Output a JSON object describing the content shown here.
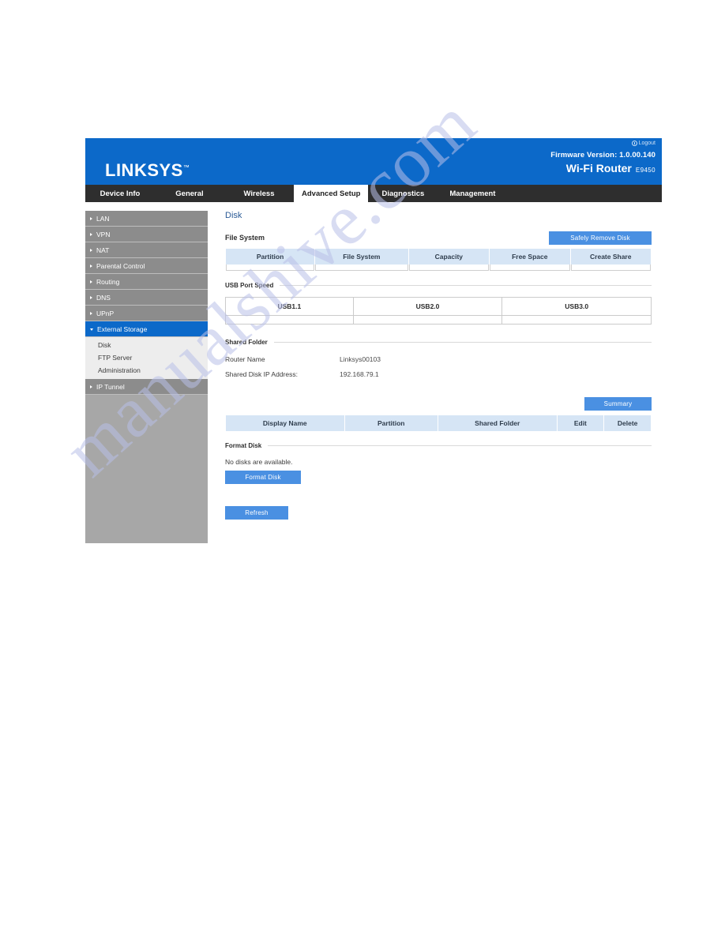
{
  "header": {
    "logout_label": "Logout",
    "logout_icon": "power-icon",
    "firmware": "Firmware Version: 1.0.00.140",
    "product": "Wi-Fi Router",
    "model": "E9450",
    "brand": "LINKSYS",
    "brand_mark": "™"
  },
  "topnav": {
    "tabs": [
      {
        "label": "Device Info",
        "active": false
      },
      {
        "label": "General",
        "active": false
      },
      {
        "label": "Wireless",
        "active": false
      },
      {
        "label": "Advanced Setup",
        "active": true
      },
      {
        "label": "Diagnostics",
        "active": false
      },
      {
        "label": "Management",
        "active": false
      }
    ]
  },
  "sidebar": {
    "items": [
      {
        "label": "LAN"
      },
      {
        "label": "VPN"
      },
      {
        "label": "NAT"
      },
      {
        "label": "Parental Control"
      },
      {
        "label": "Routing"
      },
      {
        "label": "DNS"
      },
      {
        "label": "UPnP"
      }
    ],
    "expanded": {
      "label": "External Storage"
    },
    "sub_items": [
      {
        "label": "Disk"
      },
      {
        "label": "FTP Server"
      },
      {
        "label": "Administration"
      }
    ],
    "items_after": [
      {
        "label": "IP Tunnel"
      }
    ]
  },
  "main": {
    "page_title": "Disk",
    "file_system": {
      "title": "File System",
      "safely_remove_label": "Safely Remove Disk",
      "columns": [
        "Partition",
        "File System",
        "Capacity",
        "Free Space",
        "Create Share"
      ],
      "rows": []
    },
    "usb_port_speed": {
      "title": "USB Port Speed",
      "columns": [
        "USB1.1",
        "USB2.0",
        "USB3.0"
      ],
      "rows": [
        [
          "",
          "",
          ""
        ]
      ]
    },
    "shared_folder": {
      "title": "Shared Folder",
      "router_name_label": "Router Name",
      "router_name_value": "Linksys00103",
      "shared_disk_ip_label": "Shared Disk IP Address:",
      "shared_disk_ip_value": "192.168.79.1",
      "summary_label": "Summary",
      "columns": [
        "Display Name",
        "Partition",
        "Shared Folder",
        "Edit",
        "Delete"
      ],
      "rows": []
    },
    "format_disk": {
      "title": "Format Disk",
      "empty_message": "No disks are available.",
      "button_label": "Format Disk"
    },
    "refresh_label": "Refresh"
  },
  "watermark": {
    "text": "manualshive.com"
  },
  "colors": {
    "brand_blue": "#0c69c9",
    "button_blue": "#4a90e2",
    "nav_dark": "#2e2e2e",
    "sidebar_gray": "#a7a7a7",
    "table_header_blue": "#d6e5f5"
  }
}
